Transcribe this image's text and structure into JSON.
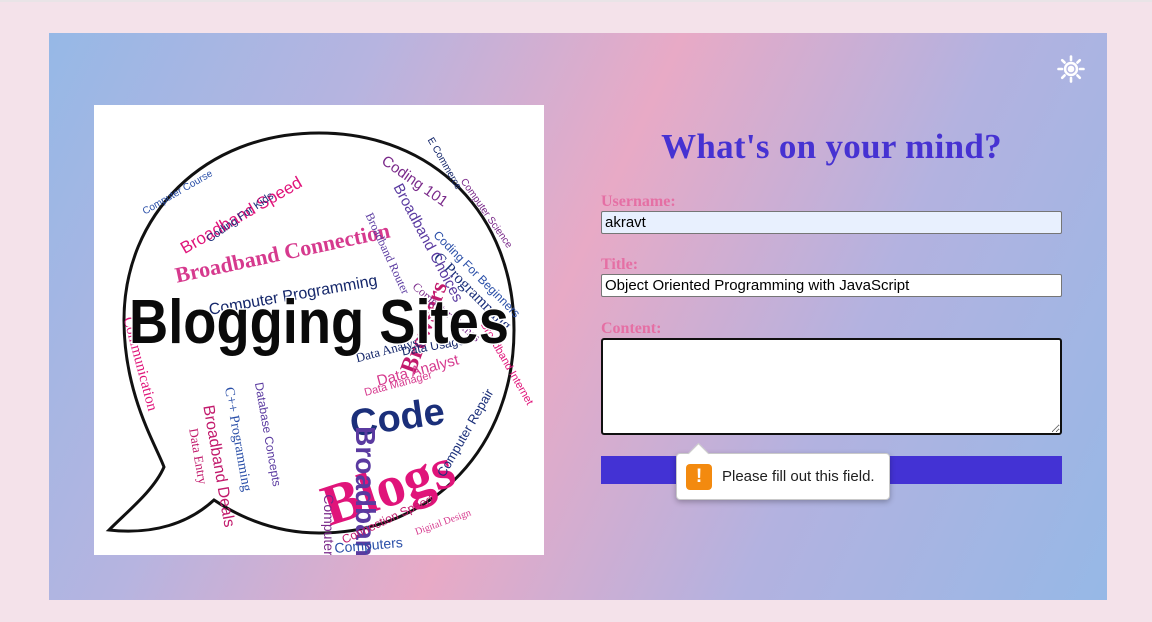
{
  "image": {
    "logo_text": "Blogging Sites",
    "big_words": [
      "Blogs",
      "Code",
      "Broadband",
      "Browsers",
      "Computers",
      "Coding 101",
      "Broadband Connection",
      "Computer Programming",
      "Broadband Speed",
      "C Programming",
      "Broadband Choices",
      "Broadband Deals",
      "C++ Programming",
      "Computer",
      "Data Analyst",
      "Data Analysis",
      "Broadband Internet",
      "Coding For Kids",
      "Broadband Router",
      "Connection Speed",
      "Computer Course",
      "Computer Games",
      "Data Manager",
      "Data Usage",
      "Communication",
      "Computer Repair",
      "Database Concepts",
      "Data Entry",
      "Coding For Beginners",
      "Computer Science",
      "Digital Design",
      "E Commerce"
    ]
  },
  "form": {
    "heading": "What's on your mind?",
    "username_label": "Username:",
    "username_value": "akravt",
    "title_label": "Title:",
    "title_value": "Object Oriented Programming with JavaScript",
    "content_label": "Content:",
    "content_value": ""
  },
  "tooltip": {
    "icon": "!",
    "text": "Please fill out this field."
  },
  "colors": {
    "page_bg": "#f4e2ea",
    "heading": "#4632d2",
    "label": "#e56fa4",
    "button": "#4332d4",
    "warning": "#f38a0f"
  },
  "icons": {
    "theme_toggle": "sun-icon"
  }
}
